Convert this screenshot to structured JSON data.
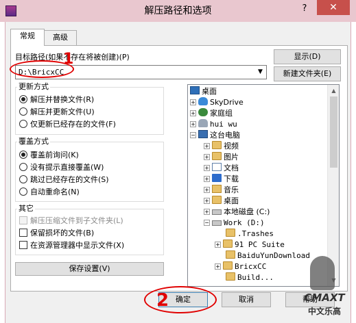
{
  "title": "解压路径和选项",
  "window_controls": {
    "help": "?",
    "close": "✕"
  },
  "tabs": [
    {
      "label": "常规",
      "active": true
    },
    {
      "label": "高级",
      "active": false
    }
  ],
  "dest": {
    "label": "目标路径(如果不存在将被创建)(P)",
    "value": "D:\\BricxCC"
  },
  "buttons": {
    "show": "显示(D)",
    "new_folder": "新建文件夹(E)",
    "save_settings": "保存设置(V)",
    "ok": "确定",
    "cancel": "取消",
    "help": "帮助"
  },
  "update_mode": {
    "title": "更新方式",
    "options": [
      {
        "label": "解压并替换文件(R)",
        "selected": true
      },
      {
        "label": "解压并更新文件(U)",
        "selected": false
      },
      {
        "label": "仅更新已经存在的文件(F)",
        "selected": false
      }
    ]
  },
  "overwrite_mode": {
    "title": "覆盖方式",
    "options": [
      {
        "label": "覆盖前询问(K)",
        "selected": true
      },
      {
        "label": "没有提示直接覆盖(W)",
        "selected": false
      },
      {
        "label": "跳过已经存在的文件(S)",
        "selected": false
      },
      {
        "label": "自动重命名(N)",
        "selected": false
      }
    ]
  },
  "misc": {
    "title": "其它",
    "options": [
      {
        "label": "解压压缩文件到子文件夹(L)",
        "checked": false,
        "disabled": true
      },
      {
        "label": "保留损坏的文件(B)",
        "checked": false,
        "disabled": false
      },
      {
        "label": "在资源管理器中显示文件(X)",
        "checked": false,
        "disabled": false
      }
    ]
  },
  "tree": [
    {
      "label": "桌面",
      "icon": "desktop-icon",
      "expander": ""
    },
    {
      "label": "SkyDrive",
      "icon": "cloud-icon",
      "expander": "+"
    },
    {
      "label": "家庭组",
      "icon": "homegroup-icon",
      "expander": "+"
    },
    {
      "label": "hui wu",
      "icon": "user-icon",
      "expander": "+"
    },
    {
      "label": "这台电脑",
      "icon": "computer-icon",
      "expander": "−"
    },
    {
      "label": "视频",
      "icon": "videos-folder-icon",
      "expander": "+"
    },
    {
      "label": "图片",
      "icon": "pictures-folder-icon",
      "expander": "+"
    },
    {
      "label": "文档",
      "icon": "documents-icon",
      "expander": "+"
    },
    {
      "label": "下载",
      "icon": "downloads-icon",
      "expander": "+"
    },
    {
      "label": "音乐",
      "icon": "music-folder-icon",
      "expander": "+"
    },
    {
      "label": "桌面",
      "icon": "desktop-folder-icon",
      "expander": "+"
    },
    {
      "label": "本地磁盘 (C:)",
      "icon": "drive-icon",
      "expander": "+"
    },
    {
      "label": "Work (D:)",
      "icon": "drive-icon",
      "expander": "−"
    },
    {
      "label": ".Trashes",
      "icon": "folder-icon",
      "expander": ""
    },
    {
      "label": "91 PC Suite",
      "icon": "folder-icon",
      "expander": "+"
    },
    {
      "label": "BaiduYunDownload",
      "icon": "folder-icon",
      "expander": ""
    },
    {
      "label": "BricxCC",
      "icon": "folder-icon",
      "expander": "+"
    },
    {
      "label": "Build...",
      "icon": "folder-icon",
      "expander": ""
    }
  ],
  "annotations": {
    "mark1": "1",
    "mark2": "2"
  },
  "watermark": {
    "brand": "CMAXT",
    "sub": "中文乐高"
  },
  "colors": {
    "titlebar": "#e9c7cf",
    "close": "#c7504b",
    "annotation": "#e00000"
  }
}
